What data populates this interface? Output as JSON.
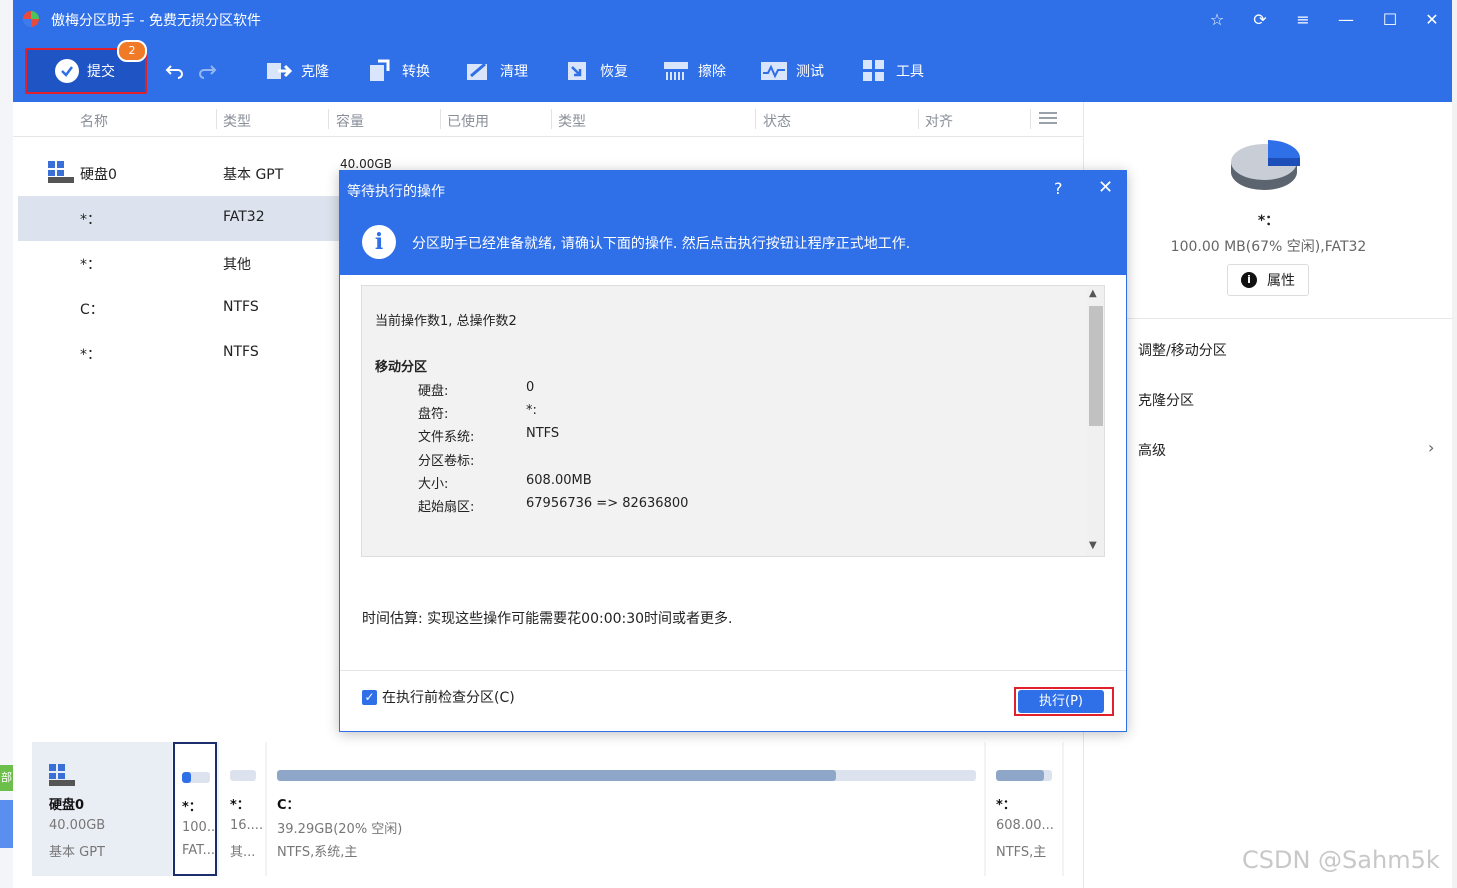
{
  "window": {
    "title": "傲梅分区助手 - 免费无损分区软件"
  },
  "toolbar": {
    "submit_label": "提交",
    "submit_badge": "2",
    "items": [
      {
        "label": "克隆",
        "icon": "clone-icon"
      },
      {
        "label": "转换",
        "icon": "convert-icon"
      },
      {
        "label": "清理",
        "icon": "clean-icon"
      },
      {
        "label": "恢复",
        "icon": "recover-icon"
      },
      {
        "label": "擦除",
        "icon": "wipe-icon"
      },
      {
        "label": "测试",
        "icon": "test-icon"
      },
      {
        "label": "工具",
        "icon": "tools-icon"
      }
    ]
  },
  "table": {
    "columns": [
      "名称",
      "类型",
      "容量",
      "已使用",
      "类型",
      "状态",
      "对齐"
    ],
    "disk": {
      "name": "硬盘0",
      "type": "基本 GPT",
      "capacity": "40.00GB"
    },
    "rows": [
      {
        "name": "*：",
        "type": "FAT32"
      },
      {
        "name": "*：",
        "type": "其他"
      },
      {
        "name": "C：",
        "type": "NTFS"
      },
      {
        "name": "*：",
        "type": "NTFS"
      }
    ]
  },
  "right_panel": {
    "name": "*：",
    "info": "100.00 MB(67% 空闲),FAT32",
    "properties_label": "属性",
    "actions": [
      "调整/移动分区",
      "克隆分区",
      "高级"
    ]
  },
  "disk_map": {
    "disk": {
      "name": "硬盘0",
      "size": "40.00GB",
      "type": "基本 GPT"
    },
    "partitions": [
      {
        "letter": "*：",
        "size": "100...",
        "fs": "FAT...",
        "used_fraction": 0.33
      },
      {
        "letter": "*：",
        "size": "16....",
        "fs": "其...",
        "used_fraction": 0.0
      },
      {
        "letter": "C：",
        "size": "39.29GB(20% 空闲)",
        "fs": "NTFS,系统,主",
        "used_fraction": 0.8
      },
      {
        "letter": "*：",
        "size": "608.00...",
        "fs": "NTFS,主",
        "used_fraction": 0.85
      }
    ]
  },
  "dialog": {
    "title": "等待执行的操作",
    "help": "?",
    "close": "✕",
    "message": "分区助手已经准备就绪, 请确认下面的操作. 然后点击执行按钮让程序正式地工作.",
    "count_line": "当前操作数1, 总操作数2",
    "operation_title": "移动分区",
    "details": [
      {
        "key": "硬盘:",
        "value": "0"
      },
      {
        "key": "盘符:",
        "value": "*:"
      },
      {
        "key": "文件系统:",
        "value": "NTFS"
      },
      {
        "key": "分区卷标:",
        "value": ""
      },
      {
        "key": "大小:",
        "value": "608.00MB"
      },
      {
        "key": "起始扇区:",
        "value": "67956736 => 82636800"
      }
    ],
    "time_estimate": "时间估算: 实现这些操作可能需要花00:00:30时间或者更多.",
    "check_label": "在执行前检查分区(C)",
    "check_checked": true,
    "execute_label": "执行(P)"
  },
  "left_strip_text": "部",
  "watermark": "CSDN @Sahm5k",
  "colors": {
    "primary": "#2f6fe8",
    "highlight": "#e0202a",
    "badge": "#f07a25",
    "selected_row": "#dde3ee"
  }
}
